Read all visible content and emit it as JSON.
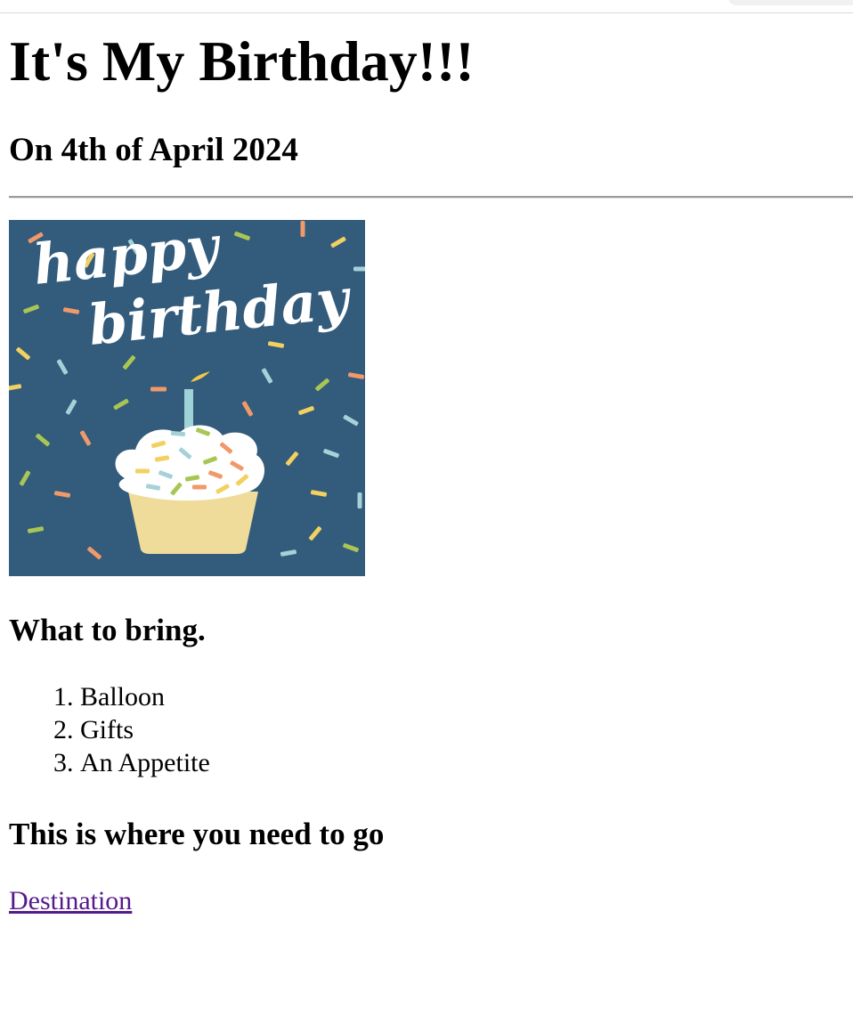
{
  "page": {
    "title": "It's My Birthday!!!",
    "date": "On 4th of April 2024"
  },
  "banner": {
    "line1": "happy",
    "line2": "birthday",
    "background_color": "#335b7b",
    "cupcake_frosting_color": "#ffffff",
    "cupcake_wrapper_color": "#f0dc9a",
    "candle_color": "#9fd3d8",
    "flame_color": "#f2c84b",
    "sprinkle_colors": [
      "#f0996b",
      "#f2d061",
      "#a6d1d9",
      "#a9c655"
    ]
  },
  "bring": {
    "heading": "What to bring.",
    "items": [
      "Balloon",
      "Gifts",
      "An Appetite"
    ]
  },
  "directions": {
    "heading": "This is where you need to go",
    "link_label": "Destination",
    "link_color": "#551a8b"
  }
}
